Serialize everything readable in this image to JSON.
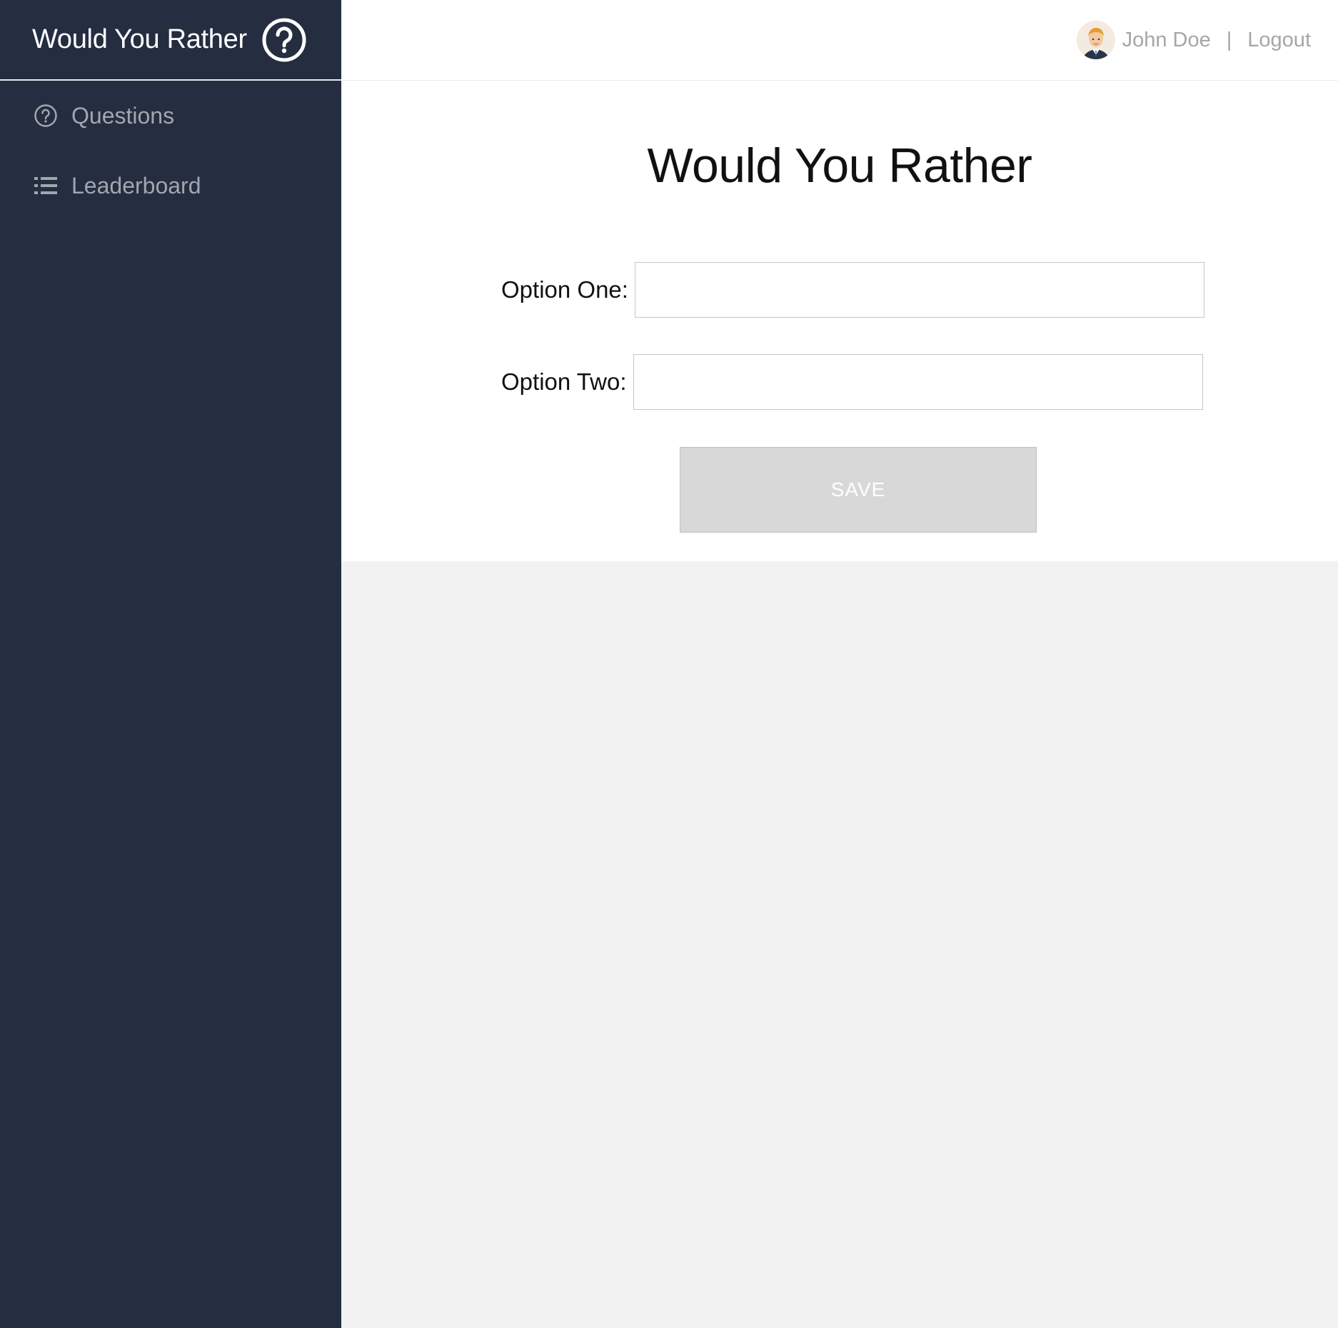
{
  "sidebar": {
    "brand_title": "Would You Rather",
    "brand_icon": "question-circle-icon",
    "items": [
      {
        "label": "Questions",
        "icon": "question-circle-icon"
      },
      {
        "label": "Leaderboard",
        "icon": "list-icon"
      }
    ]
  },
  "header": {
    "user_name": "John Doe",
    "separator": "|",
    "logout_label": "Logout",
    "avatar_icon": "avatar-icon"
  },
  "main": {
    "title": "Would You Rather",
    "option_one_label": "Option One:",
    "option_one_value": "",
    "option_two_label": "Option Two:",
    "option_two_value": "",
    "save_label": "SAVE"
  },
  "colors": {
    "sidebar_bg": "#252d40",
    "nav_text": "#a2a6ae",
    "button_bg": "#d8d8d8",
    "page_bg": "#f2f2f2"
  }
}
